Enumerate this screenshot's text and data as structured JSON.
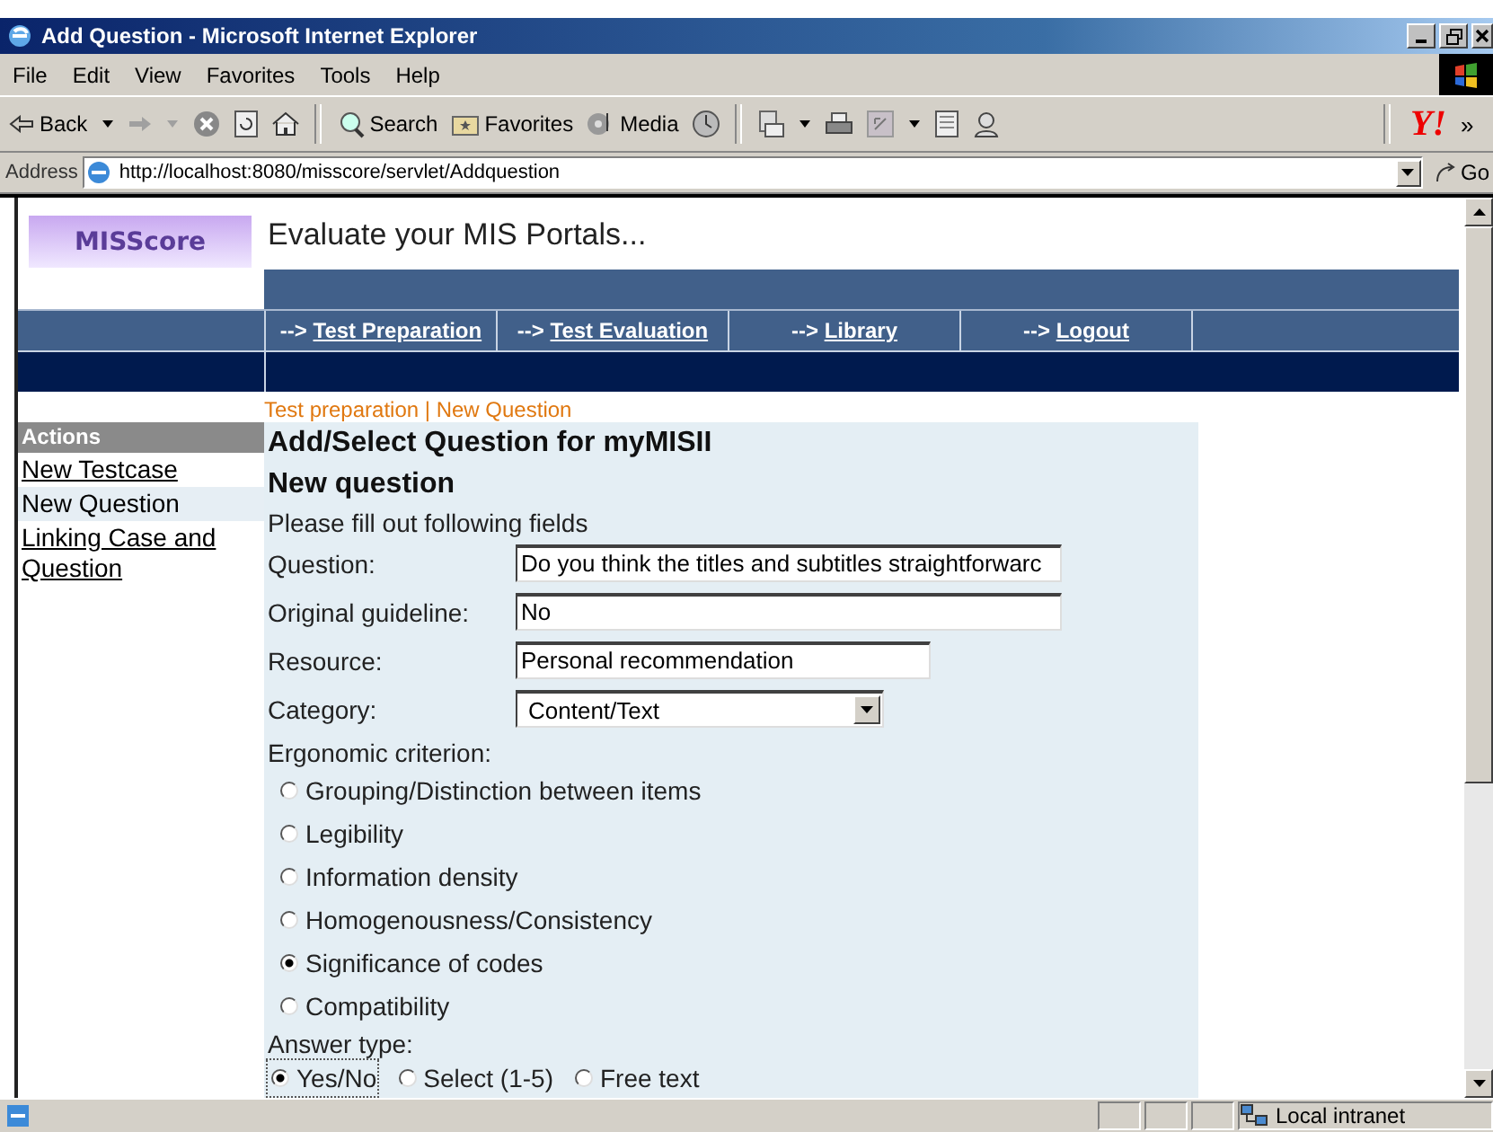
{
  "window": {
    "title": "Add Question - Microsoft Internet Explorer"
  },
  "menu": [
    "File",
    "Edit",
    "View",
    "Favorites",
    "Tools",
    "Help"
  ],
  "toolbar": [
    {
      "kind": "back",
      "label": "Back"
    },
    {
      "kind": "forward"
    },
    {
      "kind": "stop"
    },
    {
      "kind": "refresh"
    },
    {
      "kind": "home"
    },
    {
      "kind": "separator"
    },
    {
      "kind": "search",
      "label": "Search"
    },
    {
      "kind": "favorites",
      "label": "Favorites"
    },
    {
      "kind": "media",
      "label": "Media"
    },
    {
      "kind": "history"
    },
    {
      "kind": "separator"
    },
    {
      "kind": "mail"
    },
    {
      "kind": "print"
    },
    {
      "kind": "edit"
    },
    {
      "kind": "discuss"
    },
    {
      "kind": "messenger"
    }
  ],
  "links_bar": {
    "logo": "Y!",
    "more": "»"
  },
  "address": {
    "label": "Address",
    "url": "http://localhost:8080/misscore/servlet/Addquestion",
    "go": "Go"
  },
  "page": {
    "logo": "MISScore",
    "tagline": "Evaluate your MIS Portals...",
    "nav": [
      {
        "prefix": "-->",
        "label": "Test Preparation"
      },
      {
        "prefix": "-->",
        "label": "Test Evaluation"
      },
      {
        "prefix": "-->",
        "label": "Library"
      },
      {
        "prefix": "-->",
        "label": "Logout"
      }
    ],
    "breadcrumb": "Test preparation | New Question",
    "sidebar": {
      "title": "Actions",
      "items": [
        {
          "label": "New Testcase",
          "selected": false
        },
        {
          "label": "New Question",
          "selected": true
        },
        {
          "label": "Linking Case and Question",
          "selected": false
        }
      ]
    },
    "form": {
      "heading": "Add/Select Question for myMISII",
      "subheading": "New question",
      "instruction": "Please fill out following fields",
      "fields": [
        {
          "kind": "text",
          "label": "Question:",
          "value": "Do you think the titles and subtitles straightforwarc"
        },
        {
          "kind": "text",
          "label": "Original guideline:",
          "value": "No"
        },
        {
          "kind": "text",
          "label": "Resource:",
          "value": "Personal recommendation"
        },
        {
          "kind": "select",
          "label": "Category:",
          "value": "Content/Text"
        }
      ],
      "criterion_label": "Ergonomic criterion:",
      "criteria": [
        {
          "label": "Grouping/Distinction between items",
          "selected": false
        },
        {
          "label": "Legibility",
          "selected": false
        },
        {
          "label": "Information density",
          "selected": false
        },
        {
          "label": "Homogenousness/Consistency",
          "selected": false
        },
        {
          "label": "Significance of codes",
          "selected": true
        },
        {
          "label": "Compatibility",
          "selected": false
        }
      ],
      "answer_label": "Answer type:",
      "answer_types": [
        {
          "label": "Yes/No",
          "selected": true
        },
        {
          "label": "Select (1-5)",
          "selected": false
        },
        {
          "label": "Free text",
          "selected": false
        }
      ]
    }
  },
  "status_bar": {
    "zone": "Local intranet"
  }
}
